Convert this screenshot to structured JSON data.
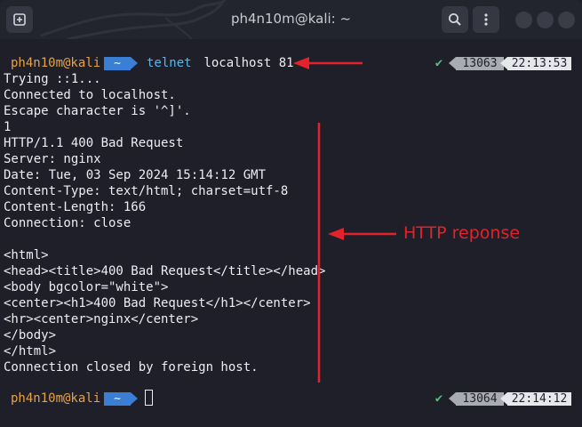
{
  "window": {
    "title": "ph4n10m@kali: ~",
    "buttons": [
      "new-tab",
      "search",
      "menu"
    ],
    "icons": {
      "new_tab": "new-tab-icon",
      "search": "search-icon",
      "menu": "kebab-menu-icon"
    }
  },
  "prompts": [
    {
      "user": "ph4n10m@kali",
      "dir": "~",
      "command_name": "telnet",
      "command_args": " localhost 81",
      "status": "✔",
      "history_no": "13063",
      "time": "22:13:53"
    },
    {
      "user": "ph4n10m@kali",
      "dir": "~",
      "command_name": "",
      "command_args": "",
      "status": "✔",
      "history_no": "13064",
      "time": "22:14:12"
    }
  ],
  "output_lines": [
    "Trying ::1...",
    "Connected to localhost.",
    "Escape character is '^]'.",
    "1",
    "HTTP/1.1 400 Bad Request",
    "Server: nginx",
    "Date: Tue, 03 Sep 2024 15:14:12 GMT",
    "Content-Type: text/html; charset=utf-8",
    "Content-Length: 166",
    "Connection: close",
    "",
    "<html>",
    "<head><title>400 Bad Request</title></head>",
    "<body bgcolor=\"white\">",
    "<center><h1>400 Bad Request</h1></center>",
    "<hr><center>nginx</center>",
    "</body>",
    "</html>",
    "Connection closed by foreign host."
  ],
  "annotation": {
    "label": "HTTP reponse",
    "color": "#e3222b"
  },
  "colors": {
    "background": "#1e1f29",
    "prompt_user": "#e5a24a",
    "prompt_dir": "#3a7ed6",
    "command": "#5ab6e8",
    "status_ok": "#55c077"
  }
}
